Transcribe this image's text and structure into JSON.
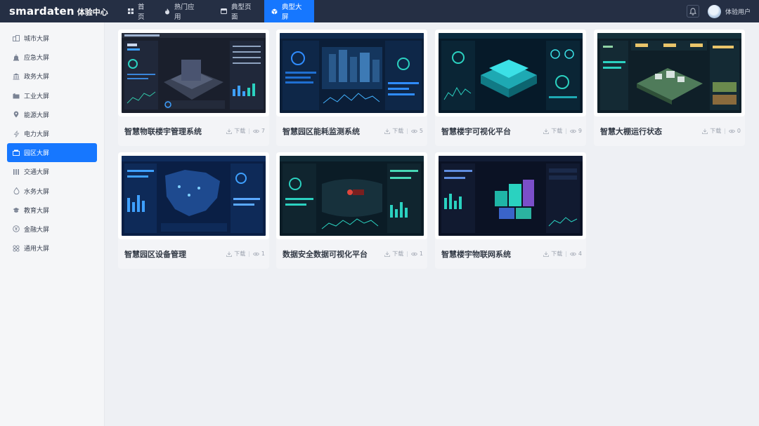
{
  "header": {
    "brand": "smardaten",
    "subtitle": "体验中心",
    "nav": [
      {
        "label": "首页",
        "icon": "grid-icon",
        "active": false
      },
      {
        "label": "热门应用",
        "icon": "flame-icon",
        "active": false
      },
      {
        "label": "典型页面",
        "icon": "window-icon",
        "active": false
      },
      {
        "label": "典型大屏",
        "icon": "cube-icon",
        "active": true
      }
    ],
    "user": "体验用户"
  },
  "sidebar": {
    "items": [
      {
        "label": "城市大屏",
        "icon": "city-icon"
      },
      {
        "label": "应急大屏",
        "icon": "siren-icon"
      },
      {
        "label": "政务大屏",
        "icon": "government-icon"
      },
      {
        "label": "工业大屏",
        "icon": "factory-icon"
      },
      {
        "label": "能源大屏",
        "icon": "location-pin-icon"
      },
      {
        "label": "电力大屏",
        "icon": "power-icon"
      },
      {
        "label": "园区大屏",
        "icon": "park-icon"
      },
      {
        "label": "交通大屏",
        "icon": "traffic-icon"
      },
      {
        "label": "水务大屏",
        "icon": "water-drop-icon"
      },
      {
        "label": "教育大屏",
        "icon": "graduation-cap-icon"
      },
      {
        "label": "金融大屏",
        "icon": "finance-icon"
      },
      {
        "label": "通用大屏",
        "icon": "general-icon"
      }
    ],
    "active_index": 6
  },
  "cards": [
    {
      "title": "智慧物联楼宇管理系统",
      "download": "下载",
      "views": "7",
      "theme": "#1c2233"
    },
    {
      "title": "智慧园区能耗监测系统",
      "download": "下载",
      "views": "5",
      "theme": "#0d2340"
    },
    {
      "title": "智慧楼宇可视化平台",
      "download": "下载",
      "views": "9",
      "theme": "#071d2e"
    },
    {
      "title": "智慧大棚运行状态",
      "download": "下载",
      "views": "0",
      "theme": "#10202a"
    },
    {
      "title": "智慧园区设备管理",
      "download": "下载",
      "views": "1",
      "theme": "#0a2146"
    },
    {
      "title": "数据安全数据可视化平台",
      "download": "下载",
      "views": "1",
      "theme": "#0c1e28"
    },
    {
      "title": "智慧楼宇物联网系统",
      "download": "下载",
      "views": "4",
      "theme": "#0c1426"
    }
  ],
  "colors": {
    "topbar": "#252f44",
    "accent": "#1677ff",
    "page_bg": "#eef0f4"
  }
}
